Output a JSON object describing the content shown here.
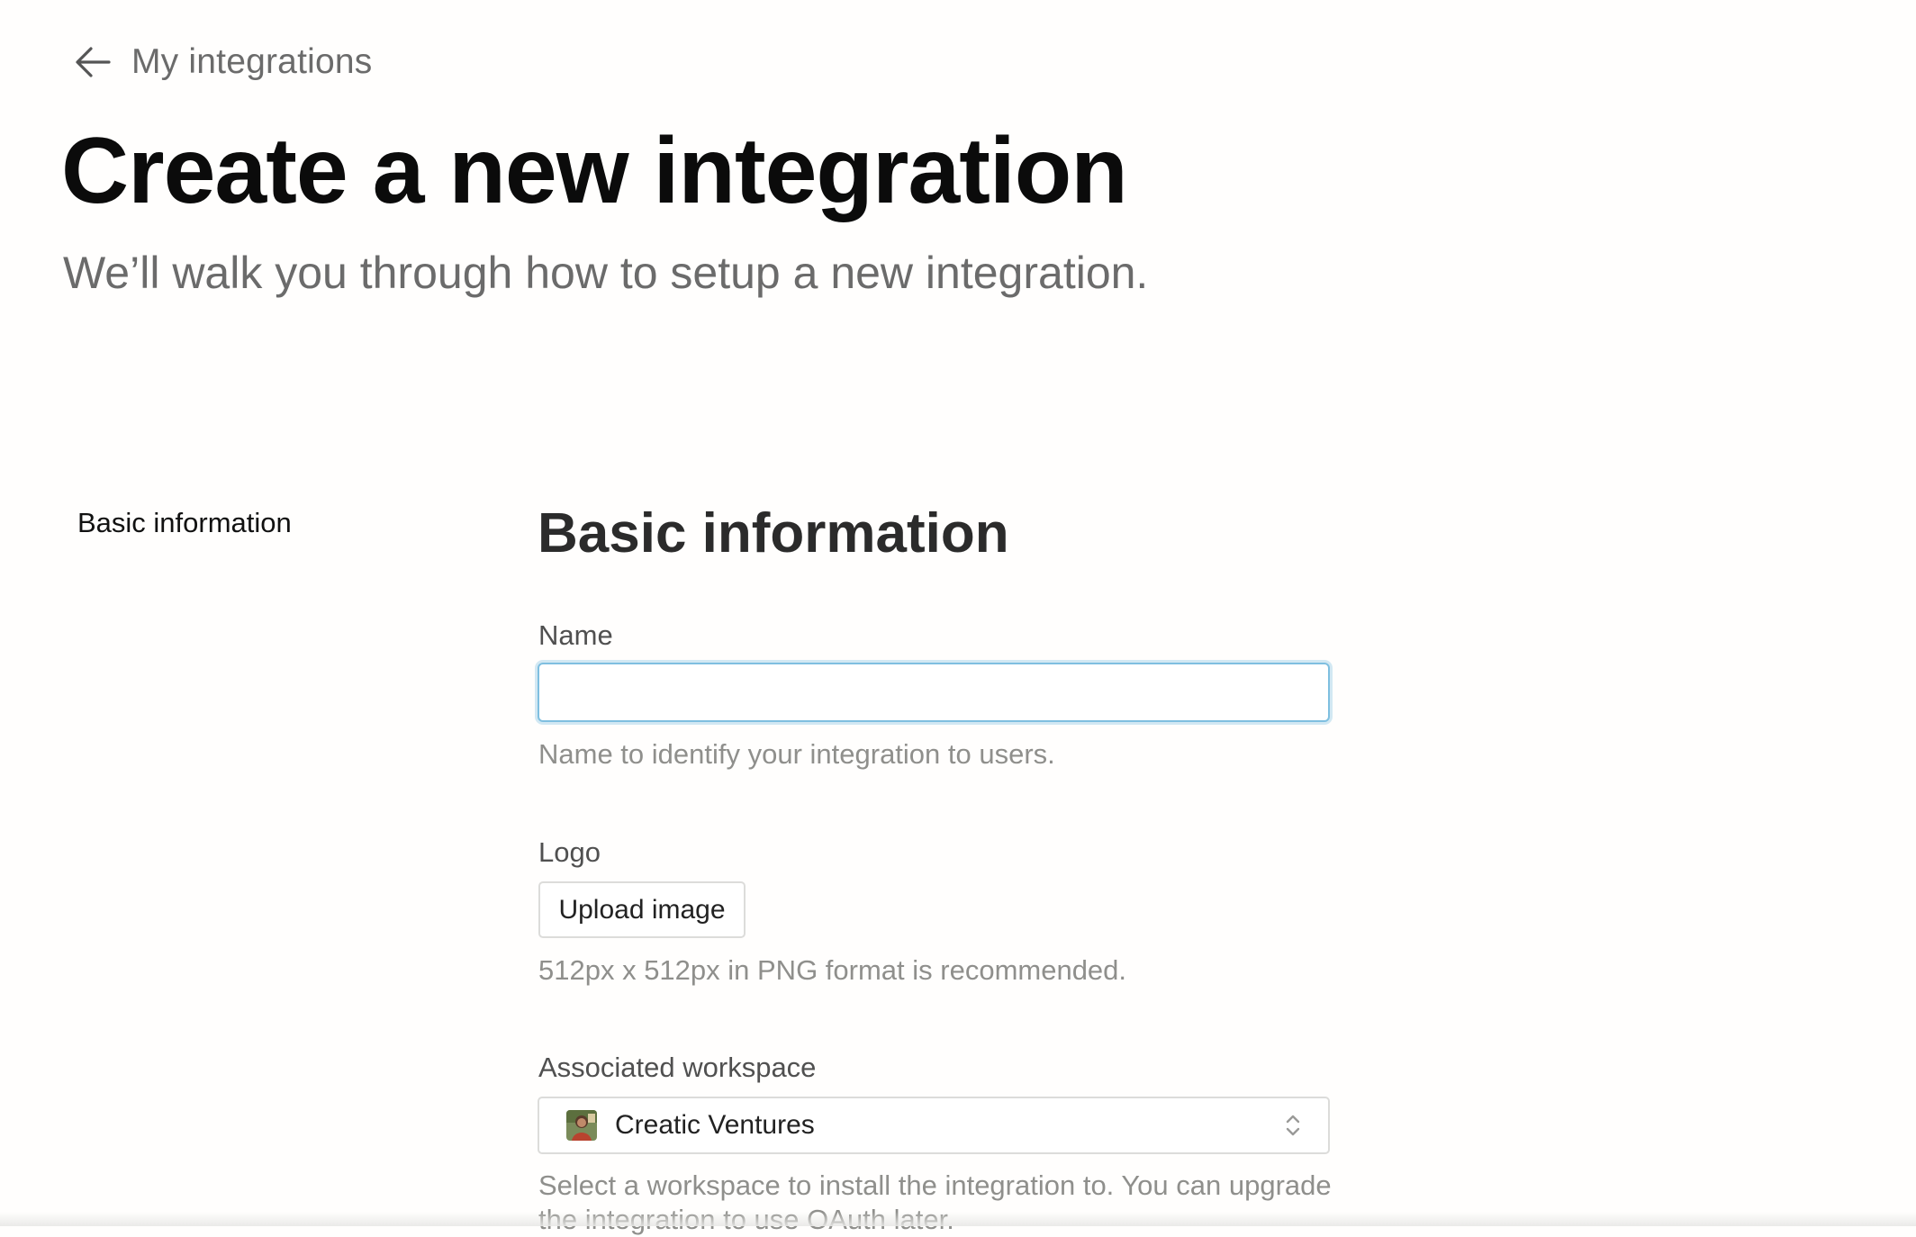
{
  "nav": {
    "back_label": "My integrations",
    "back_icon": "arrow-left-icon"
  },
  "header": {
    "title": "Create a new integration",
    "subtitle": "We’ll walk you through how to setup a new integration."
  },
  "sidebar": {
    "items": [
      {
        "label": "Basic information"
      }
    ]
  },
  "form": {
    "section_title": "Basic information",
    "name": {
      "label": "Name",
      "value": "",
      "placeholder": "",
      "hint": "Name to identify your integration to users."
    },
    "logo": {
      "label": "Logo",
      "button_label": "Upload image",
      "hint": "512px x 512px in PNG format is recommended."
    },
    "workspace": {
      "label": "Associated workspace",
      "selected": "Creatic Ventures",
      "icon": "workspace-avatar",
      "hint": "Select a workspace to install the integration to. You can upgrade the integration to use OAuth later."
    }
  },
  "colors": {
    "focus_border": "#7fbfe0",
    "title_text": "#0b0b0b",
    "muted_text": "#8f8f8c",
    "background": "#fffefd"
  }
}
